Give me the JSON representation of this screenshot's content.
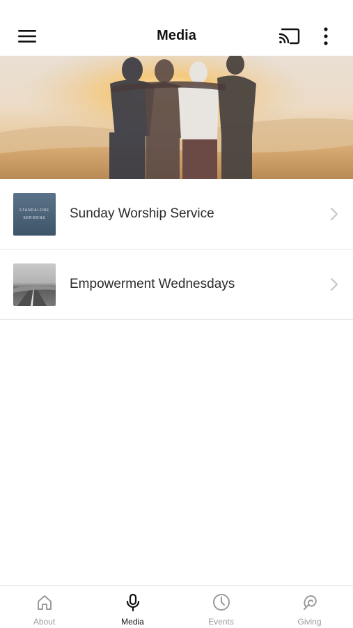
{
  "header": {
    "title": "Media",
    "menu_icon": "hamburger-menu-icon",
    "cast_icon": "cast-icon",
    "more_icon": "more-vertical-icon"
  },
  "list": {
    "items": [
      {
        "label": "Sunday Worship Service",
        "thumb_line1": "STANDALONE",
        "thumb_line2": "SERMONS"
      },
      {
        "label": "Empowerment Wednesdays"
      }
    ]
  },
  "bottom_nav": {
    "tabs": [
      {
        "label": "About",
        "icon": "home-icon"
      },
      {
        "label": "Media",
        "icon": "microphone-icon",
        "active": true
      },
      {
        "label": "Events",
        "icon": "clock-icon"
      },
      {
        "label": "Giving",
        "icon": "giving-icon"
      }
    ]
  },
  "colors": {
    "active_tab": "#111111",
    "inactive_tab": "#9a9a9a",
    "divider": "#e6e6e6"
  }
}
